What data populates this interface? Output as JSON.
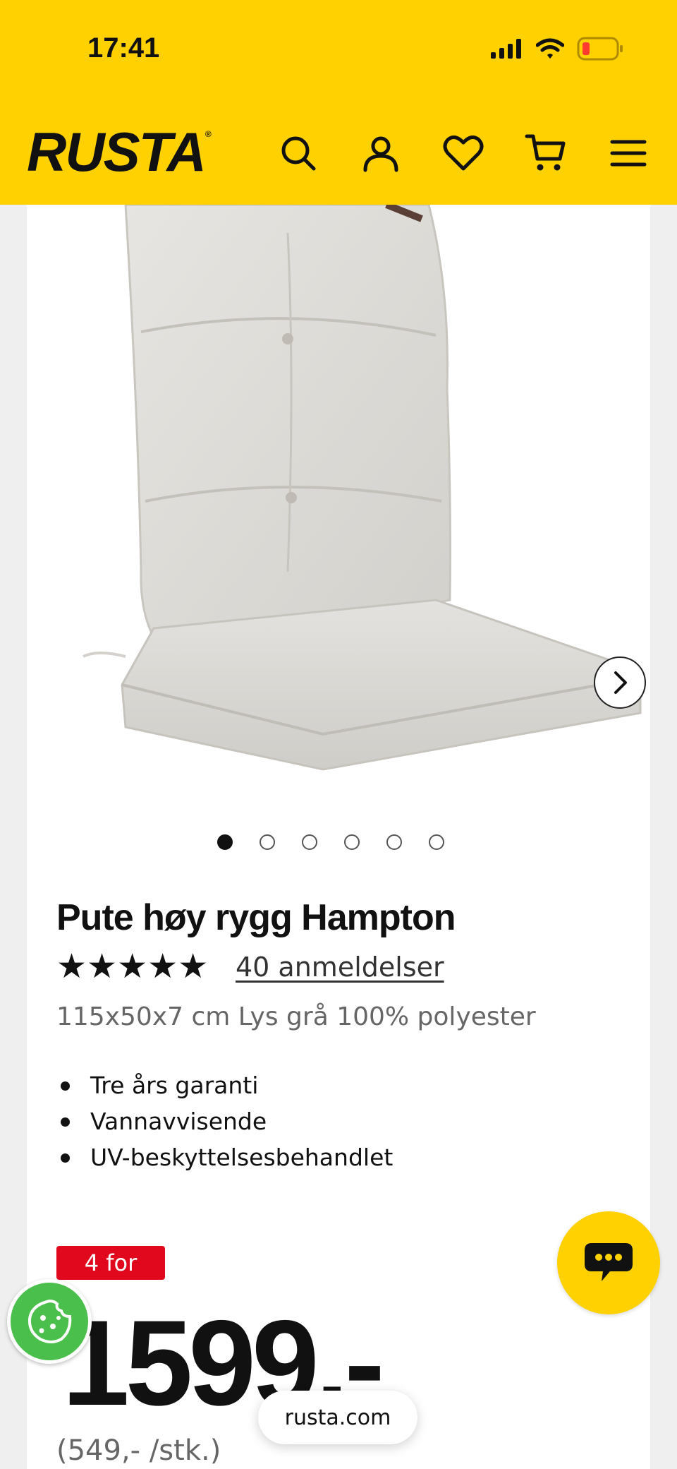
{
  "status_bar": {
    "time": "17:41",
    "battery_color": "#ff3b30"
  },
  "header": {
    "brand": "RUSTA",
    "brand_mark": "®",
    "background": "#ffd100",
    "icons": [
      "search-icon",
      "account-icon",
      "heart-icon",
      "cart-icon",
      "menu-icon"
    ]
  },
  "gallery": {
    "slide_count": 6,
    "active_slide": 1,
    "image_description": "light grey high-back chair cushion"
  },
  "product": {
    "title": "Pute høy rygg Hampton",
    "rating": 5,
    "reviews_link": "40 anmeldelser",
    "description": "115x50x7 cm Lys grå 100% polyester",
    "features": [
      "Tre års garanti",
      "Vannavvisende",
      "UV-beskyttelsesbehandlet"
    ]
  },
  "pricing": {
    "badge": "4 for",
    "badge_color": "#e1081e",
    "price": "1599,-",
    "unit_price": "(549,- /stk.)"
  },
  "overlays": {
    "url": "rusta.com",
    "chat_color": "#ffd100",
    "cookie_color": "#4bbf4b"
  }
}
